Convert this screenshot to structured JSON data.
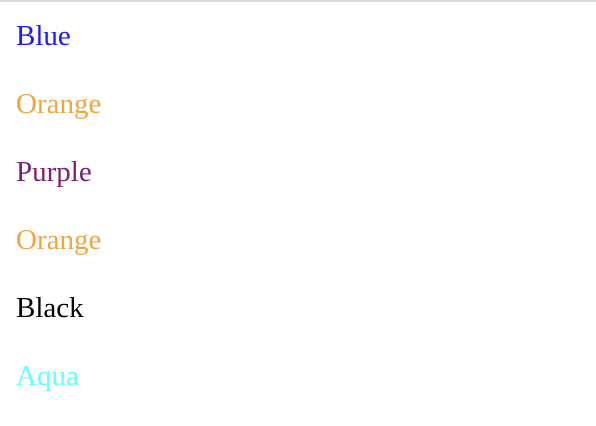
{
  "items": [
    {
      "label": "Blue",
      "color": "#1a1aff"
    },
    {
      "label": "Orange",
      "color": "#f0a640"
    },
    {
      "label": "Purple",
      "color": "#7a1f7a"
    },
    {
      "label": "Orange",
      "color": "#f0a640"
    },
    {
      "label": "Black",
      "color": "#000000"
    },
    {
      "label": "Aqua",
      "color": "#66ffff"
    }
  ]
}
